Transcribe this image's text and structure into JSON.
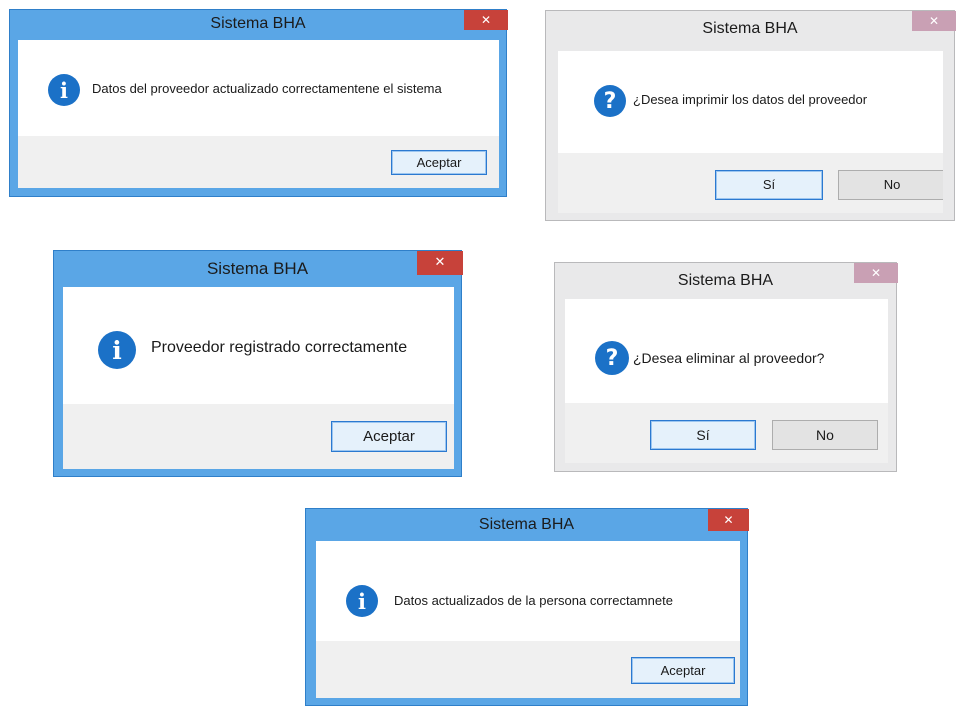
{
  "dialogs": [
    {
      "id": "info-updated",
      "title": "Sistema BHA",
      "close_glyph": "✕",
      "icon": "info-icon",
      "icon_glyph": "i",
      "message": "Datos del proveedor actualizado correctamentene el sistema",
      "buttons": [
        {
          "label": "Aceptar",
          "name": "aceptar-button"
        }
      ]
    },
    {
      "id": "confirm-print",
      "title": "Sistema BHA",
      "close_glyph": "✕",
      "icon": "question-icon",
      "icon_glyph": "?",
      "message": "¿Desea imprimir los datos del proveedor",
      "buttons": [
        {
          "label": "Sí",
          "name": "si-button"
        },
        {
          "label": "No",
          "name": "no-button"
        }
      ]
    },
    {
      "id": "info-registered",
      "title": "Sistema BHA",
      "close_glyph": "✕",
      "icon": "info-icon",
      "icon_glyph": "i",
      "message": "Proveedor registrado correctamente",
      "buttons": [
        {
          "label": "Aceptar",
          "name": "aceptar-button"
        }
      ]
    },
    {
      "id": "confirm-delete",
      "title": "Sistema BHA",
      "close_glyph": "✕",
      "icon": "question-icon",
      "icon_glyph": "?",
      "message": "¿Desea eliminar al proveedor?",
      "buttons": [
        {
          "label": "Sí",
          "name": "si-button"
        },
        {
          "label": "No",
          "name": "no-button"
        }
      ]
    },
    {
      "id": "info-person-updated",
      "title": "Sistema BHA",
      "close_glyph": "✕",
      "icon": "info-icon",
      "icon_glyph": "i",
      "message": "Datos actualizados de la persona correctamnete",
      "buttons": [
        {
          "label": "Aceptar",
          "name": "aceptar-button"
        }
      ]
    }
  ],
  "colors": {
    "active_frame": "#5aa6e6",
    "inactive_frame": "#e9e9ea",
    "close_active": "#c7423a",
    "close_inactive": "#c9a0b4",
    "icon_blue": "#1b71c7",
    "footer": "#f0f0f0"
  }
}
